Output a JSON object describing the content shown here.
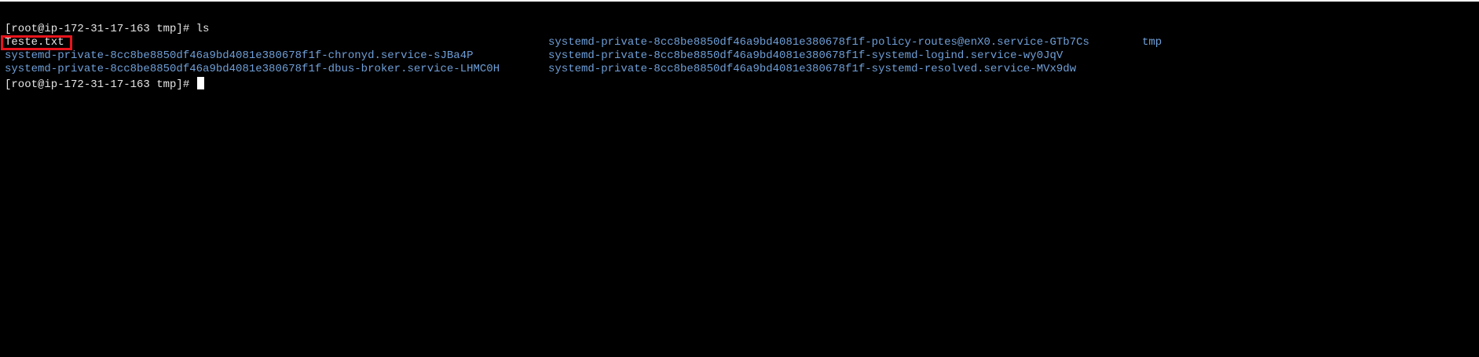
{
  "terminal": {
    "prompt_1": "[root@ip-172-31-17-163 tmp]# ls",
    "prompt_2": "[root@ip-172-31-17-163 tmp]# ",
    "ls_output": {
      "file_plain": "Teste.txt",
      "dir_1": "systemd-private-8cc8be8850df46a9bd4081e380678f1f-chronyd.service-sJBa4P",
      "dir_2": "systemd-private-8cc8be8850df46a9bd4081e380678f1f-dbus-broker.service-LHMC0H",
      "dir_3": "systemd-private-8cc8be8850df46a9bd4081e380678f1f-policy-routes@enX0.service-GTb7Cs",
      "dir_4": "systemd-private-8cc8be8850df46a9bd4081e380678f1f-systemd-logind.service-wy0JqV",
      "dir_5": "systemd-private-8cc8be8850df46a9bd4081e380678f1f-systemd-resolved.service-MVx9dw",
      "dir_6": "tmp"
    },
    "colors": {
      "background": "#000000",
      "text": "#e6e6e6",
      "directory": "#6f9fd8",
      "annotation": "#e8141c"
    }
  }
}
